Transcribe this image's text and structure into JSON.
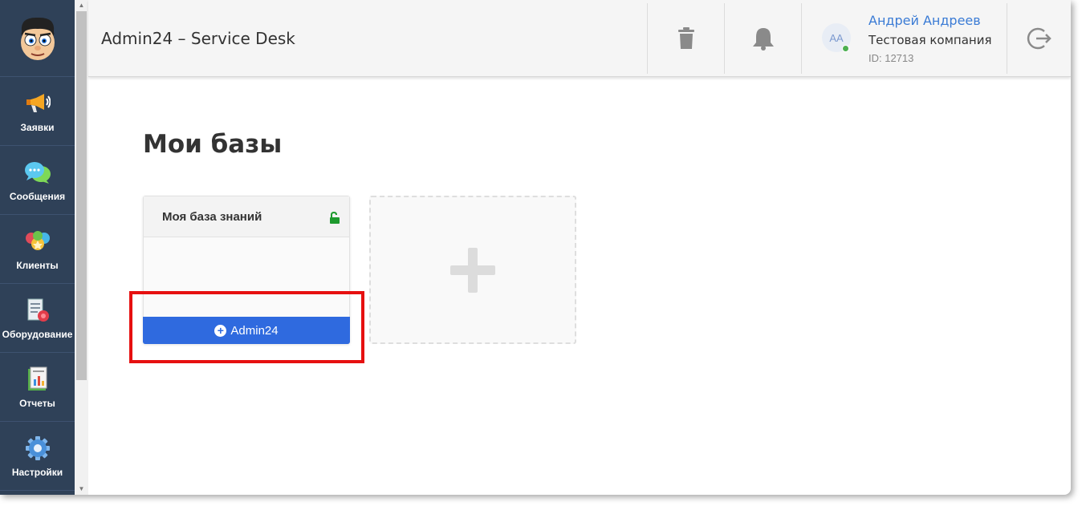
{
  "app": {
    "title": "Admin24 – Service Desk"
  },
  "sidebar": {
    "logo_icon": "cartoon-face-logo",
    "items": [
      {
        "label": "Заявки",
        "icon": "megaphone-icon"
      },
      {
        "label": "Сообщения",
        "icon": "chat-bubbles-icon"
      },
      {
        "label": "Клиенты",
        "icon": "clients-icon"
      },
      {
        "label": "Оборудование",
        "icon": "equipment-icon"
      },
      {
        "label": "Отчеты",
        "icon": "report-icon"
      },
      {
        "label": "Настройки",
        "icon": "gear-icon"
      }
    ]
  },
  "header": {
    "trash_icon": "trash-icon",
    "bell_icon": "bell-icon",
    "logout_icon": "logout-icon",
    "user": {
      "initials": "AA",
      "name": "Андрей Андреев",
      "company": "Тестовая компания",
      "id": "ID: 12713",
      "status_color": "#4caf50"
    }
  },
  "main": {
    "title": "Мои базы",
    "cards": [
      {
        "title": "Моя база знаний",
        "lock_icon": "unlock-icon",
        "button_label": "Admin24"
      }
    ],
    "add_card_icon": "plus-icon"
  },
  "colors": {
    "sidebar_bg": "#2f4158",
    "accent_blue": "#2f6adf",
    "highlight_red": "#e61010",
    "link_blue": "#3a7bd5"
  }
}
